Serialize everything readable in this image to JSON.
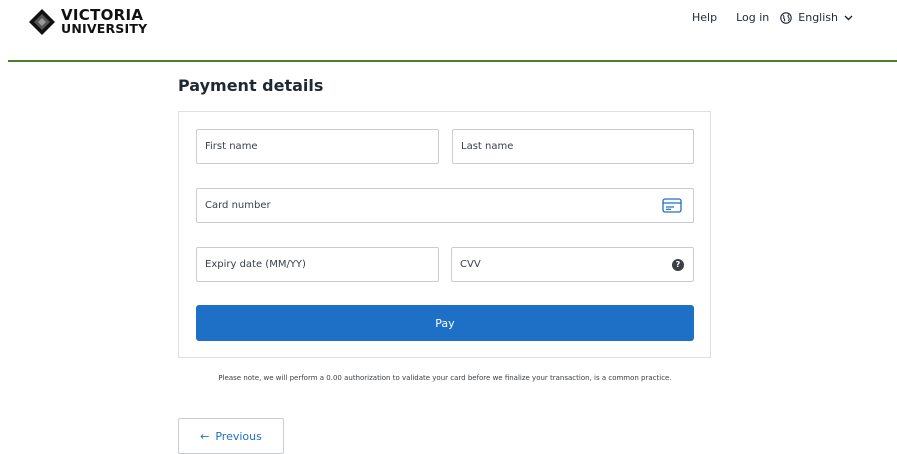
{
  "header": {
    "logo": {
      "line1": "VICTORIA",
      "line2": "UNIVERSITY"
    },
    "nav": {
      "help": "Help",
      "login": "Log in",
      "language": "English"
    }
  },
  "page": {
    "title": "Payment details"
  },
  "form": {
    "first_name": {
      "placeholder": "First name",
      "value": ""
    },
    "last_name": {
      "placeholder": "Last name",
      "value": ""
    },
    "card_number": {
      "placeholder": "Card number",
      "value": ""
    },
    "expiry": {
      "placeholder": "Expiry date (MM/YY)",
      "value": ""
    },
    "cvv": {
      "placeholder": "CVV",
      "value": "",
      "help_symbol": "?"
    },
    "pay_label": "Pay"
  },
  "note": "Please note, we will perform a 0.00 authorization to validate your card before we finalize your transaction, is a common practice.",
  "footer": {
    "previous_arrow": "←",
    "previous_label": "Previous"
  },
  "colors": {
    "accent": "#1e6fc6",
    "brand_rule": "#4a7d2e",
    "border": "#c9cdd2"
  },
  "icons": [
    "globe-icon",
    "chevron-down-icon",
    "credit-card-icon",
    "question-icon",
    "arrow-left-icon"
  ]
}
